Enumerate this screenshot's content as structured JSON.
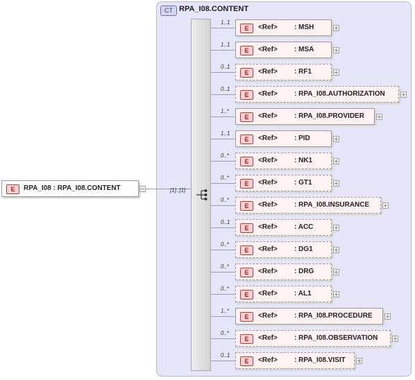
{
  "complex_type": {
    "tag": "CT",
    "title": "RPA_I08.CONTENT"
  },
  "root": {
    "tag": "E",
    "label": "RPA_I08 : RPA_I08.CONTENT",
    "multiplicity": "[1]..[1]"
  },
  "children": [
    {
      "tag": "E",
      "ref": "<Ref>",
      "name": ": MSH",
      "multiplicity": "1..1",
      "optional": false
    },
    {
      "tag": "E",
      "ref": "<Ref>",
      "name": ": MSA",
      "multiplicity": "1..1",
      "optional": false
    },
    {
      "tag": "E",
      "ref": "<Ref>",
      "name": ": RF1",
      "multiplicity": "0..1",
      "optional": true
    },
    {
      "tag": "E",
      "ref": "<Ref>",
      "name": ": RPA_I08.AUTHORIZATION",
      "multiplicity": "0..1",
      "optional": true
    },
    {
      "tag": "E",
      "ref": "<Ref>",
      "name": ": RPA_I08.PROVIDER",
      "multiplicity": "1..*",
      "optional": false
    },
    {
      "tag": "E",
      "ref": "<Ref>",
      "name": ": PID",
      "multiplicity": "1..1",
      "optional": false
    },
    {
      "tag": "E",
      "ref": "<Ref>",
      "name": ": NK1",
      "multiplicity": "0..*",
      "optional": true
    },
    {
      "tag": "E",
      "ref": "<Ref>",
      "name": ": GT1",
      "multiplicity": "0..*",
      "optional": true
    },
    {
      "tag": "E",
      "ref": "<Ref>",
      "name": ": RPA_I08.INSURANCE",
      "multiplicity": "0..*",
      "optional": true
    },
    {
      "tag": "E",
      "ref": "<Ref>",
      "name": ": ACC",
      "multiplicity": "0..1",
      "optional": true
    },
    {
      "tag": "E",
      "ref": "<Ref>",
      "name": ": DG1",
      "multiplicity": "0..*",
      "optional": true
    },
    {
      "tag": "E",
      "ref": "<Ref>",
      "name": ": DRG",
      "multiplicity": "0..*",
      "optional": true
    },
    {
      "tag": "E",
      "ref": "<Ref>",
      "name": ": AL1",
      "multiplicity": "0..*",
      "optional": true
    },
    {
      "tag": "E",
      "ref": "<Ref>",
      "name": ": RPA_I08.PROCEDURE",
      "multiplicity": "1..*",
      "optional": false
    },
    {
      "tag": "E",
      "ref": "<Ref>",
      "name": ": RPA_I08.OBSERVATION",
      "multiplicity": "0..*",
      "optional": true
    },
    {
      "tag": "E",
      "ref": "<Ref>",
      "name": ": RPA_I08.VISIT",
      "multiplicity": "0..1",
      "optional": true
    }
  ]
}
